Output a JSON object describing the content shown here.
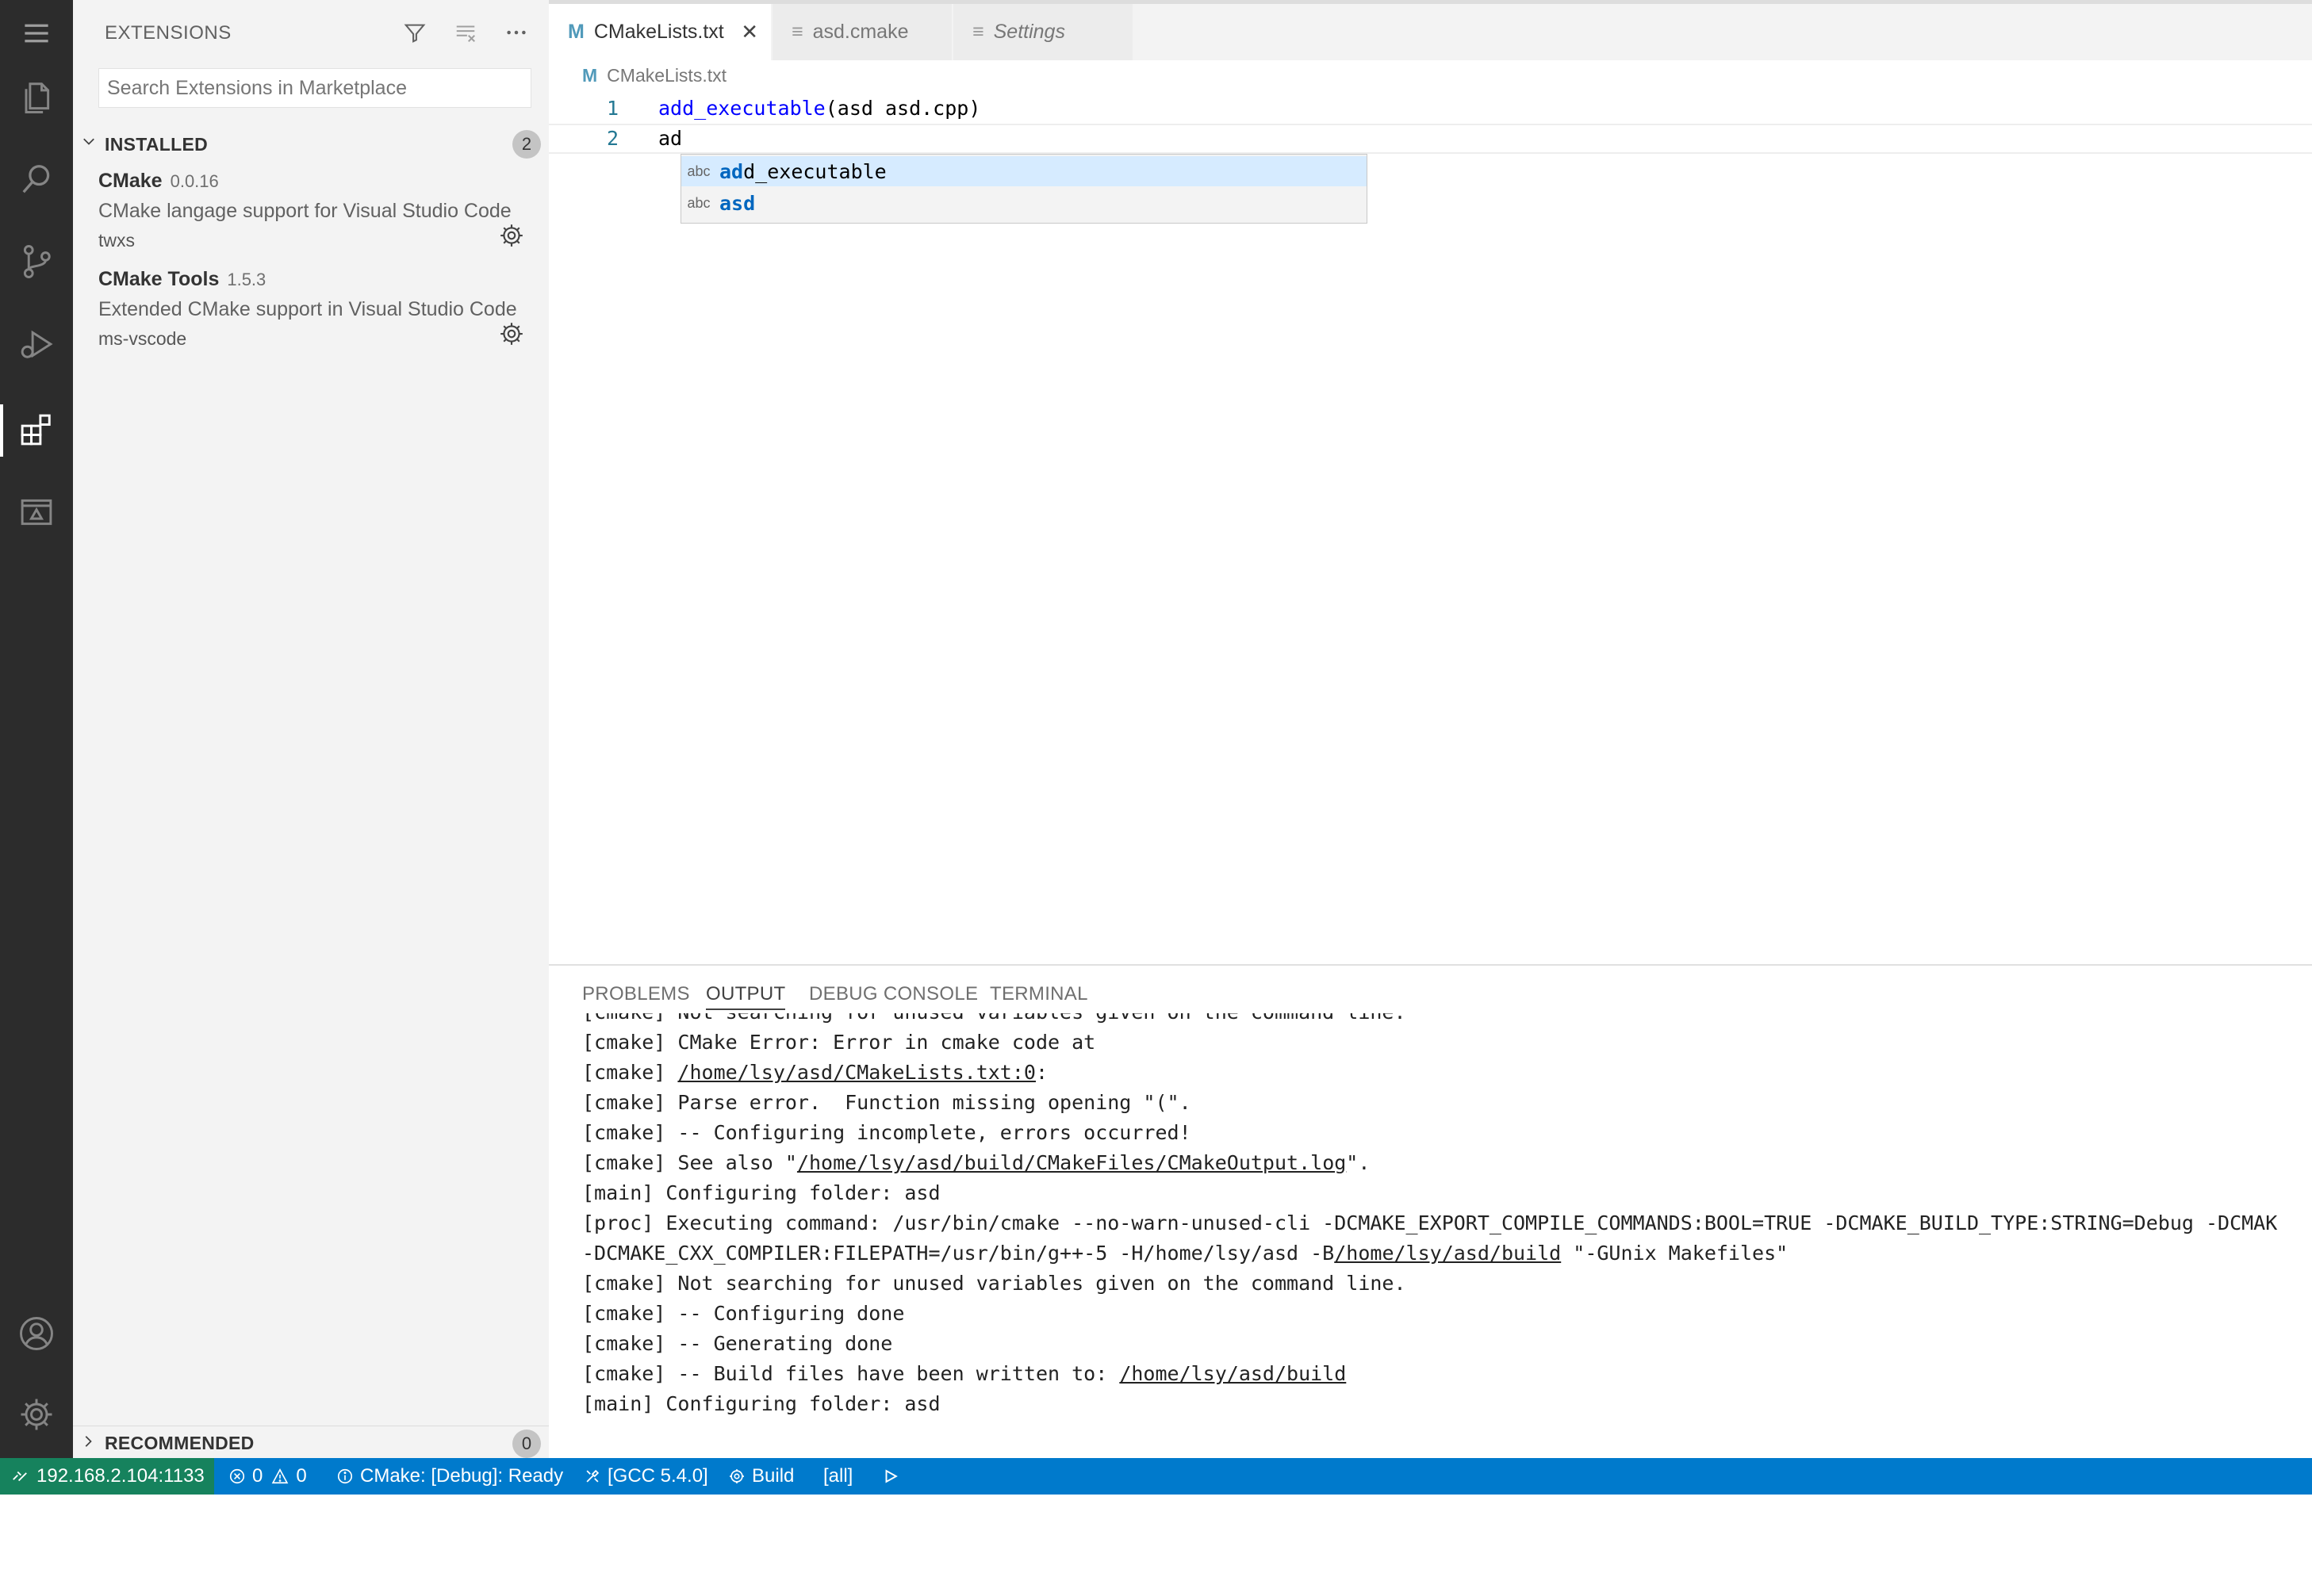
{
  "activity_bar": {
    "icons": [
      "menu-icon",
      "explorer-icon",
      "search-icon",
      "source-control-icon",
      "run-debug-icon",
      "extensions-icon",
      "remote-explorer-icon",
      "account-icon",
      "manage-gear-icon"
    ]
  },
  "sidebar": {
    "title": "EXTENSIONS",
    "search_placeholder": "Search Extensions in Marketplace",
    "installed": {
      "label": "INSTALLED",
      "count": "2",
      "items": [
        {
          "name": "CMake",
          "version": "0.0.16",
          "description": "CMake langage support for Visual Studio Code",
          "publisher": "twxs"
        },
        {
          "name": "CMake Tools",
          "version": "1.5.3",
          "description": "Extended CMake support in Visual Studio Code",
          "publisher": "ms-vscode"
        }
      ]
    },
    "recommended": {
      "label": "RECOMMENDED",
      "count": "0"
    }
  },
  "tabs": [
    {
      "label": "CMakeLists.txt",
      "icon": "M",
      "active": true
    },
    {
      "label": "asd.cmake",
      "icon": "≡",
      "active": false
    },
    {
      "label": "Settings",
      "icon": "≡",
      "active": false
    }
  ],
  "editor": {
    "breadcrumb": "CMakeLists.txt",
    "lines": [
      {
        "number": "1",
        "fn": "add_executable",
        "rest": "(asd asd.cpp)"
      },
      {
        "number": "2",
        "text": "ad"
      }
    ],
    "suggestions": [
      {
        "kind": "abc",
        "match": "ad",
        "rest": "d_executable",
        "full": "add_executable"
      },
      {
        "kind": "abc",
        "match": "asd",
        "rest": "",
        "full": "asd"
      }
    ]
  },
  "panel": {
    "tabs": [
      "PROBLEMS",
      "OUTPUT",
      "DEBUG CONSOLE",
      "TERMINAL"
    ],
    "active_tab": "OUTPUT",
    "output_lines": [
      {
        "pre": "[cmake] Not searching for unused variables given on the command line.",
        "link": "",
        "post": ""
      },
      {
        "pre": "[cmake] CMake Error: Error in cmake code at",
        "link": "",
        "post": ""
      },
      {
        "pre": "[cmake] ",
        "link": "/home/lsy/asd/CMakeLists.txt:0",
        "post": ":"
      },
      {
        "pre": "[cmake] Parse error.  Function missing opening \"(\".",
        "link": "",
        "post": ""
      },
      {
        "pre": "[cmake] -- Configuring incomplete, errors occurred!",
        "link": "",
        "post": ""
      },
      {
        "pre": "[cmake] See also \"",
        "link": "/home/lsy/asd/build/CMakeFiles/CMakeOutput.log",
        "post": "\"."
      },
      {
        "pre": "[main] Configuring folder: asd",
        "link": "",
        "post": ""
      },
      {
        "pre": "[proc] Executing command: /usr/bin/cmake --no-warn-unused-cli -DCMAKE_EXPORT_COMPILE_COMMANDS:BOOL=TRUE -DCMAKE_BUILD_TYPE:STRING=Debug -DCMAK",
        "link": "",
        "post": ""
      },
      {
        "pre": "-DCMAKE_CXX_COMPILER:FILEPATH=/usr/bin/g++-5 -H/home/lsy/asd -B",
        "link": "/home/lsy/asd/build",
        "post": " \"-GUnix Makefiles\""
      },
      {
        "pre": "[cmake] Not searching for unused variables given on the command line.",
        "link": "",
        "post": ""
      },
      {
        "pre": "[cmake] -- Configuring done",
        "link": "",
        "post": ""
      },
      {
        "pre": "[cmake] -- Generating done",
        "link": "",
        "post": ""
      },
      {
        "pre": "[cmake] -- Build files have been written to: ",
        "link": "/home/lsy/asd/build",
        "post": ""
      },
      {
        "pre": "[main] Configuring folder: asd",
        "link": "",
        "post": ""
      }
    ]
  },
  "status_bar": {
    "remote": "192.168.2.104:1133",
    "errors": "0",
    "warnings": "0",
    "cmake_status": "CMake: [Debug]: Ready",
    "kit": "[GCC 5.4.0]",
    "build": "Build",
    "target": "[all]"
  },
  "colors": {
    "status_bar": "#007acc",
    "remote_indicator": "#16825d",
    "activity_bar": "#2c2c2c",
    "sidebar": "#f3f3f3",
    "keyword": "#0000ff",
    "suggest_highlight": "#0066bf"
  }
}
